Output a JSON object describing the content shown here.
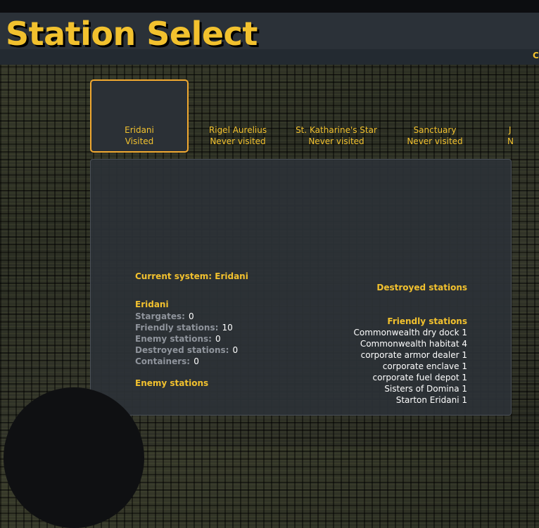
{
  "header": {
    "title": "Station Select",
    "edge_text": "C"
  },
  "tabs": [
    {
      "name": "Eridani",
      "status": "Visited",
      "selected": true
    },
    {
      "name": "Rigel Aurelius",
      "status": "Never visited",
      "selected": false
    },
    {
      "name": "St. Katharine's Star",
      "status": "Never visited",
      "selected": false
    },
    {
      "name": "Sanctuary",
      "status": "Never visited",
      "selected": false
    },
    {
      "name": "J",
      "status": "N",
      "selected": false
    }
  ],
  "details": {
    "current_system_label": "Current system: Eridani",
    "system_name": "Eridani",
    "stats": [
      {
        "label": "Stargates:",
        "value": "0"
      },
      {
        "label": "Friendly stations:",
        "value": "10"
      },
      {
        "label": "Enemy stations:",
        "value": "0"
      },
      {
        "label": "Destroyed stations:",
        "value": "0"
      },
      {
        "label": "Containers:",
        "value": "0"
      }
    ],
    "enemy_header": "Enemy stations",
    "destroyed_header": "Destroyed stations",
    "friendly_header": "Friendly stations",
    "friendly_list": [
      "Commonwealth dry dock 1",
      "Commonwealth habitat 4",
      "corporate armor dealer 1",
      "corporate enclave 1",
      "corporate fuel depot 1",
      "Sisters of Domina 1",
      "Starton Eridani 1"
    ]
  },
  "colors": {
    "accent": "#f2c12e",
    "selected_border": "#f0a830",
    "panel": "#2c3137"
  }
}
